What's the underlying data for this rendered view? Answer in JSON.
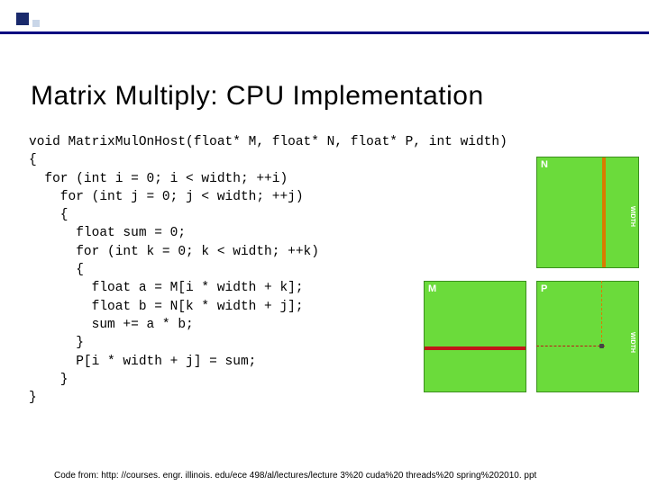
{
  "title": "Matrix Multiply:  CPU Implementation",
  "code": "void MatrixMulOnHost(float* M, float* N, float* P, int width)\n{\n  for (int i = 0; i < width; ++i)\n    for (int j = 0; j < width; ++j)\n    {\n      float sum = 0;\n      for (int k = 0; k < width; ++k)\n      {\n        float a = M[i * width + k];\n        float b = N[k * width + j];\n        sum += a * b;\n      }\n      P[i * width + j] = sum;\n    }\n}",
  "labels": {
    "N": "N",
    "M": "M",
    "P": "P",
    "width": "WIDTH"
  },
  "footer": "Code from:  http: //courses. engr. illinois. edu/ece 498/al/lectures/lecture 3%20 cuda%20 threads%20 spring%202010. ppt"
}
